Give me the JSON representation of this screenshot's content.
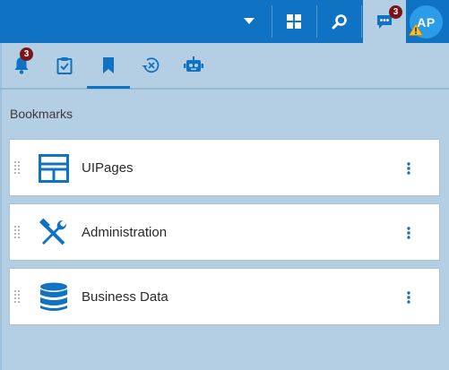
{
  "topbar": {
    "chat_badge": "3",
    "avatar_initials": "AP"
  },
  "tabs": {
    "notifications_badge": "3",
    "items": [
      {
        "name": "notifications",
        "icon": "bell-icon"
      },
      {
        "name": "tasks",
        "icon": "clipboard-check-icon"
      },
      {
        "name": "bookmarks",
        "icon": "bookmark-icon",
        "active": true
      },
      {
        "name": "history",
        "icon": "history-clear-icon"
      },
      {
        "name": "assistant",
        "icon": "robot-icon"
      }
    ]
  },
  "section": {
    "title": "Bookmarks"
  },
  "bookmarks": [
    {
      "label": "UIPages",
      "icon": "layout-icon"
    },
    {
      "label": "Administration",
      "icon": "tools-icon"
    },
    {
      "label": "Business Data",
      "icon": "database-icon"
    }
  ],
  "colors": {
    "brand": "#0f72c2",
    "panel": "#b4cfe3",
    "badge": "#7a1418",
    "avatar": "#2b9ce8",
    "warning": "#f2c03a"
  }
}
